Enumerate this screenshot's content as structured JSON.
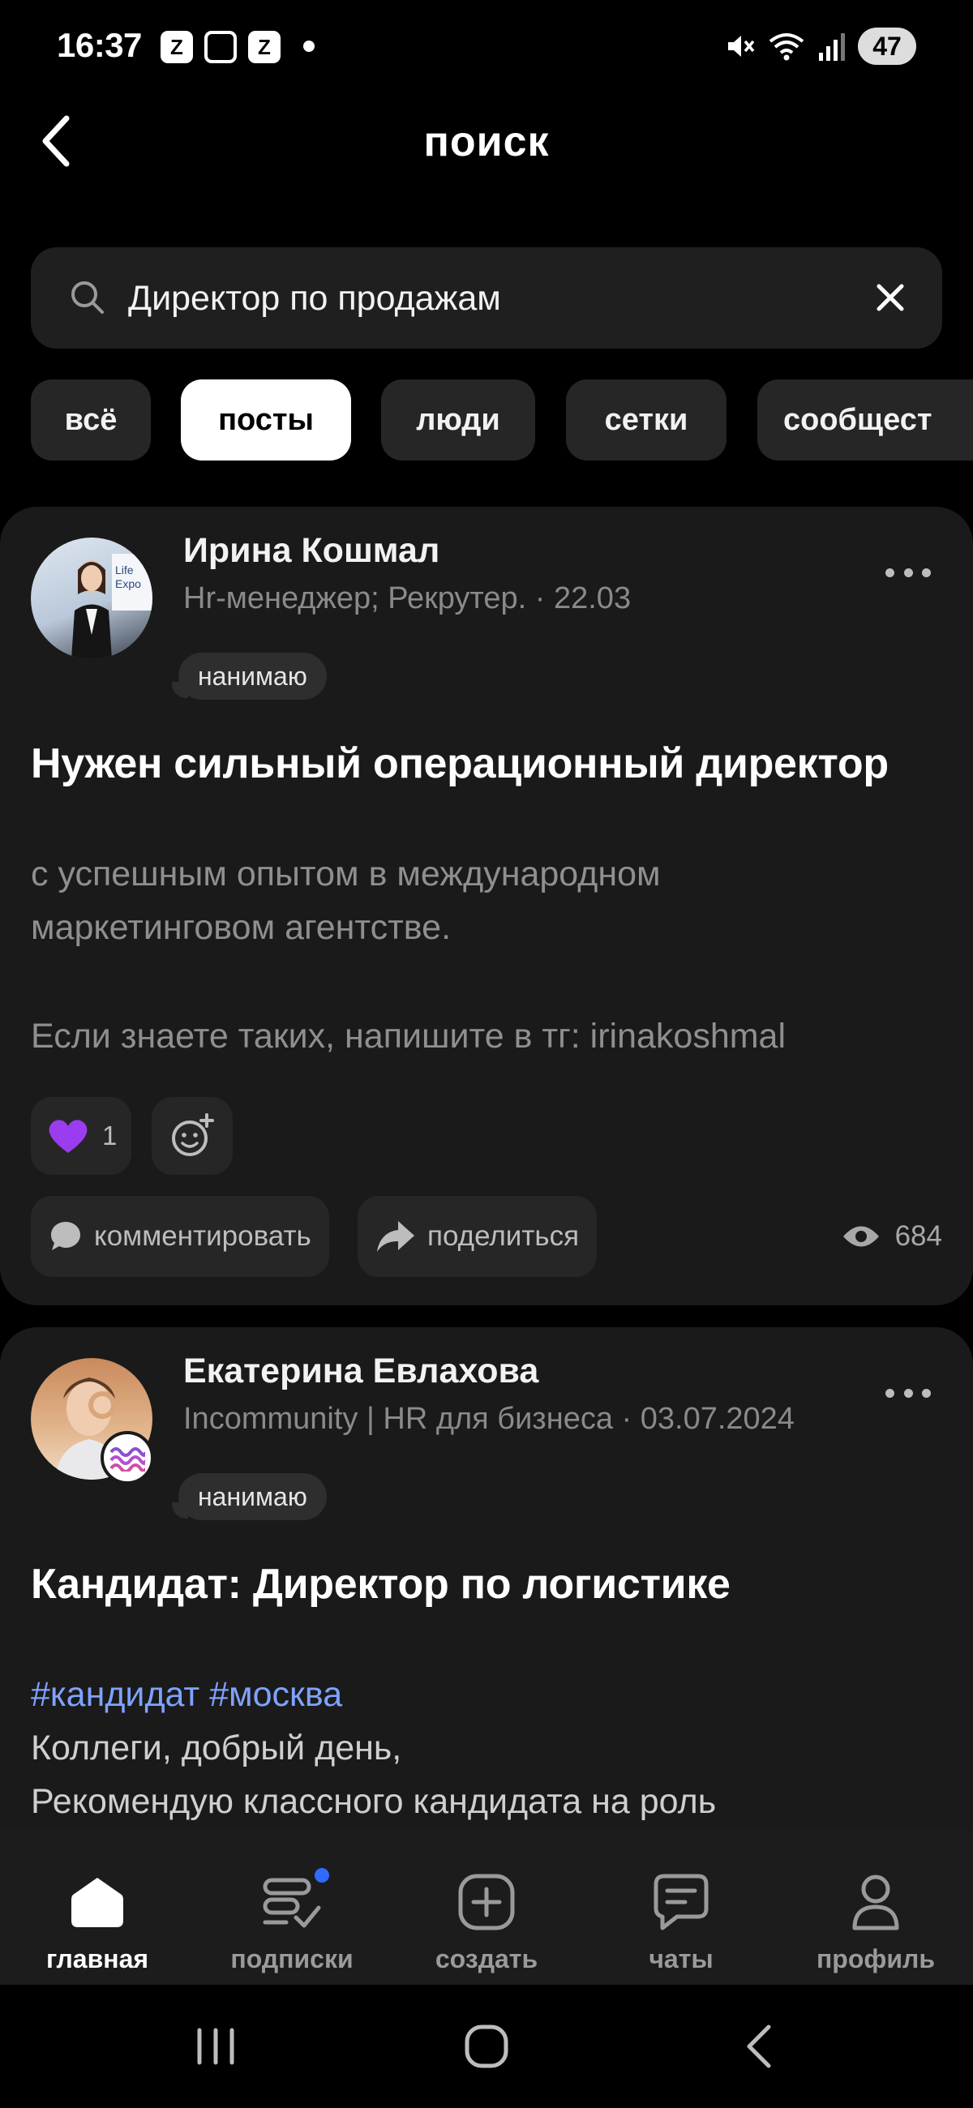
{
  "status_bar": {
    "time": "16:37",
    "battery": "47",
    "app_icons": [
      "Z",
      "Z"
    ]
  },
  "header": {
    "title": "поиск"
  },
  "search": {
    "value": "Директор по продажам",
    "placeholder": ""
  },
  "filters": [
    {
      "label": "всё",
      "active": false
    },
    {
      "label": "посты",
      "active": true
    },
    {
      "label": "люди",
      "active": false
    },
    {
      "label": "сетки",
      "active": false
    },
    {
      "label": "сообщест",
      "active": false
    }
  ],
  "posts": [
    {
      "author": "Ирина Кошмал",
      "meta": "Hr-менеджер; Рекрутер. · 22.03",
      "badge": "нанимаю",
      "title": "Нужен сильный операционный директор",
      "text_1": "с успешным опытом в международном",
      "text_2": "маркетинговом агентстве.",
      "text_3": "Если знаете таких, напишите в тг: irinakoshmal",
      "reaction_count": "1",
      "comment_label": "комментировать",
      "share_label": "поделиться",
      "views": "684",
      "avatar_text": "Life Expo"
    },
    {
      "author": "Екатерина Евлахова",
      "meta": "Incommunity | HR для бизнеса · 03.07.2024",
      "badge": "нанимаю",
      "title": "Кандидат: Директор по логистике",
      "hashtags": "#кандидат #москва",
      "text_1": "Коллеги, добрый день,",
      "text_2": "Рекомендую классного кандидата на роль"
    }
  ],
  "bottom_nav": [
    {
      "label": "главная",
      "icon": "home-icon",
      "active": true
    },
    {
      "label": "подписки",
      "icon": "subscriptions-icon",
      "active": false
    },
    {
      "label": "создать",
      "icon": "create-icon",
      "active": false
    },
    {
      "label": "чаты",
      "icon": "chats-icon",
      "active": false
    },
    {
      "label": "профиль",
      "icon": "profile-icon",
      "active": false
    }
  ],
  "colors": {
    "background": "#000000",
    "card": "#1a1a1a",
    "chip": "#262626",
    "hashtag": "#7fa2ff",
    "notification_dot": "#2f6bff",
    "reaction_heart": "#9b3cf0"
  }
}
